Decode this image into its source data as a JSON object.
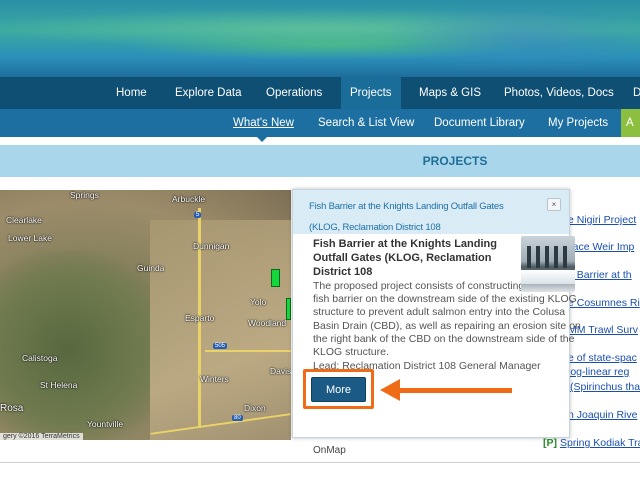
{
  "main_nav": {
    "items": [
      "Home",
      "Explore Data",
      "Operations",
      "Projects",
      "Maps & GIS",
      "Photos, Videos, Docs",
      "D"
    ],
    "active": "Projects"
  },
  "sub_nav": {
    "items": [
      "What's New",
      "Search & List View",
      "Document Library",
      "My Projects",
      "A"
    ],
    "active": "What's New"
  },
  "projects_bar": {
    "title": "PROJECTS"
  },
  "map": {
    "labels": {
      "springs": "Springs",
      "arbuckle": "Arbuckle",
      "clearlake": "Clearlake",
      "lower_lake": "Lower Lake",
      "dunnigan": "Dunnigan",
      "guinda": "Guinda",
      "esparto": "Esparto",
      "yolo": "Yolo",
      "woodland": "Woodland",
      "calistoga": "Calistoga",
      "st_helena": "St Helena",
      "winters": "Winters",
      "davis": "Davis",
      "rosa": "Rosa",
      "dixon": "Dixon",
      "yountville": "Yountville"
    },
    "shields": {
      "i5": "5",
      "i505": "505",
      "i80": "80"
    },
    "credit": "gery ©2016 TerraMetrics"
  },
  "popup": {
    "header_title": "Fish Barrier at the Knights Landing Outfall Gates (KLOG, Reclamation District 108",
    "close_label": "×",
    "body_title": "Fish Barrier at the Knights Landing Outfall Gates (KLOG, Reclamation District 108",
    "description": "The proposed project consists of constructing a positive fish barrier on the downstream side of the existing KLOG structure to prevent adult salmon entry into the Colusa Basin Drain (CBD), as well as repairing an erosion site on the right bank of the CBD on the downstream side of the KLOG structure.",
    "agency": "Lead: Reclamation District 108 General Manager",
    "more_label": "More",
    "onmap_label": "OnMap"
  },
  "side_links": [
    {
      "prefix": "",
      "text": "e Nigiri Project"
    },
    {
      "prefix": "",
      "text": "llace Weir Imp"
    },
    {
      "prefix": "",
      "text": "n Barrier at th"
    },
    {
      "prefix": "",
      "text": "e Cosumnes Ri"
    },
    {
      "prefix": "",
      "text": "MM Trawl Surv"
    },
    {
      "prefix": "",
      "text": "e of state-spac"
    },
    {
      "prefix": "",
      "text": "log-linear reg"
    },
    {
      "prefix": "",
      "text": "(Spirinchus tha"
    },
    {
      "prefix": "",
      "text": "n Joaquin Rive"
    },
    {
      "prefix": "[P]",
      "text": "Spring Kodiak Tra"
    }
  ],
  "colors": {
    "nav_bg": "#0f4f74",
    "subnav_bg": "#1c6fa0",
    "projects_bar_bg": "#a9d6ea",
    "highlight": "#f06b16",
    "more_button": "#1a5a85"
  }
}
